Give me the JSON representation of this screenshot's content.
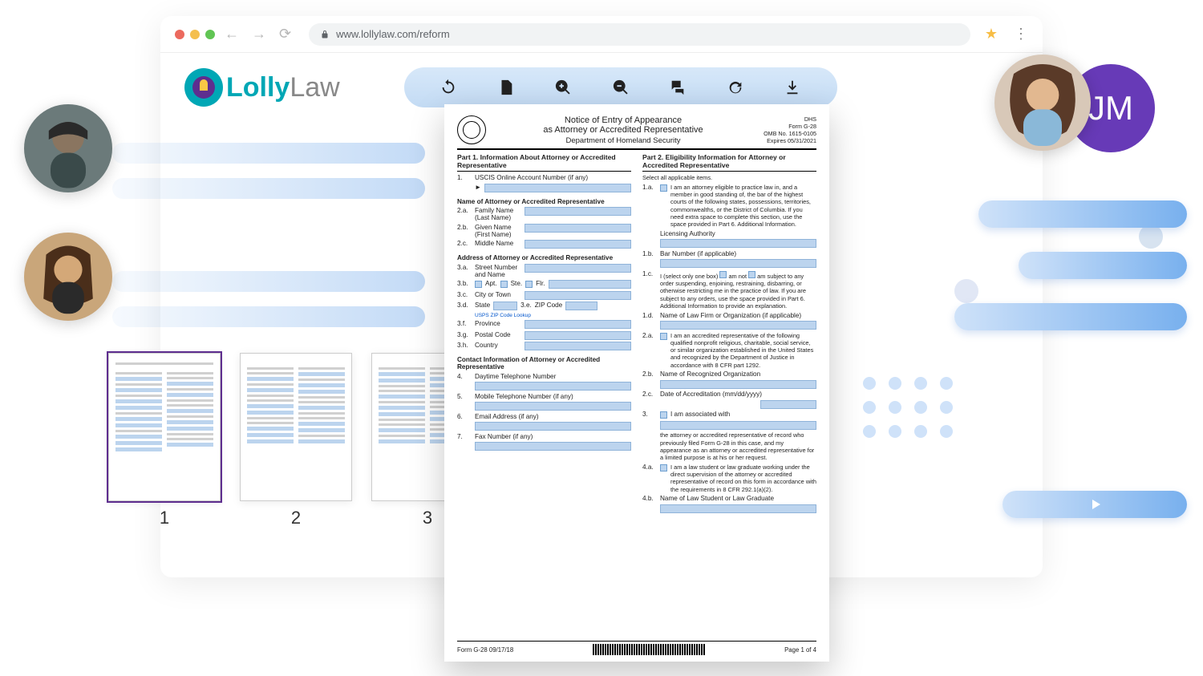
{
  "browser": {
    "url": "www.lollylaw.com/reform"
  },
  "logo": {
    "part1": "Lolly",
    "part2": "Law"
  },
  "toolbar_icons": [
    "sync",
    "document",
    "zoom-in",
    "zoom-out",
    "chat",
    "refresh",
    "download"
  ],
  "thumbs": [
    {
      "num": "1",
      "active": true
    },
    {
      "num": "2",
      "active": false
    },
    {
      "num": "3",
      "active": false
    }
  ],
  "initials": "JM",
  "form": {
    "title1": "Notice of Entry of Appearance",
    "title2": "as Attorney or Accredited Representative",
    "title3": "Department of Homeland Security",
    "meta": {
      "agency": "DHS",
      "form": "Form G-28",
      "omb": "OMB No. 1615-0105",
      "expires": "Expires 05/31/2021"
    },
    "part1_head": "Part 1.  Information About Attorney or Accredited Representative",
    "part2_head": "Part 2.  Eligibility Information for Attorney or Accredited Representative",
    "left": {
      "r1": "USCIS Online Account Number (if any)",
      "sub_name": "Name of Attorney or Accredited Representative",
      "r2a_lbl": "Family Name (Last Name)",
      "r2b_lbl": "Given Name (First Name)",
      "r2c_lbl": "Middle Name",
      "sub_addr": "Address of Attorney or Accredited Representative",
      "r3a": "Street Number and Name",
      "r3b_apt": "Apt.",
      "r3b_ste": "Ste.",
      "r3b_flr": "Flr.",
      "r3c": "City or Town",
      "r3d": "State",
      "r3e": "ZIP Code",
      "zip_link": "USPS ZIP Code Lookup",
      "r3f": "Province",
      "r3g": "Postal Code",
      "r3h": "Country",
      "sub_contact": "Contact Information of Attorney or Accredited Representative",
      "r4": "Daytime Telephone Number",
      "r5": "Mobile Telephone Number (if any)",
      "r6": "Email Address (if any)",
      "r7": "Fax Number (if any)"
    },
    "right": {
      "select_all": "Select all applicable items.",
      "r1a": "I am an attorney eligible to practice law in, and a member in good standing of, the bar of the highest courts of the following states, possessions, territories, commonwealths, or the District of Columbia.  If you need extra space to complete this section, use the space provided in Part 6. Additional Information.",
      "lic": "Licensing Authority",
      "r1b": "Bar Number (if applicable)",
      "r1c_pre": "I (select only one box)",
      "r1c_am": "am not",
      "r1c_am2": "am",
      "r1c_post": "subject to any order suspending, enjoining, restraining, disbarring, or otherwise restricting me in the practice of law.  If you are subject to any orders, use the space provided in Part 6. Additional Information to provide an explanation.",
      "r1d": "Name of Law Firm or Organization (if applicable)",
      "r2a": "I am an accredited representative of the following qualified nonprofit religious, charitable, social service, or similar organization established in the United States and recognized by the Department of Justice in accordance with 8 CFR part 1292.",
      "r2b": "Name of Recognized Organization",
      "r2c": "Date of Accreditation (mm/dd/yyyy)",
      "r3": "I am associated with",
      "r3_post": "the attorney or accredited representative of record who previously filed Form G-28 in this case, and my appearance as an attorney or accredited representative for a limited purpose is at his or her request.",
      "r4a": "I am a law student or law graduate working under the direct supervision of the attorney or accredited representative of record on this form in accordance with the requirements in 8 CFR 292.1(a)(2).",
      "r4b": "Name of Law Student or Law Graduate"
    },
    "footer": {
      "left": "Form G-28   09/17/18",
      "right": "Page 1 of 4"
    }
  }
}
